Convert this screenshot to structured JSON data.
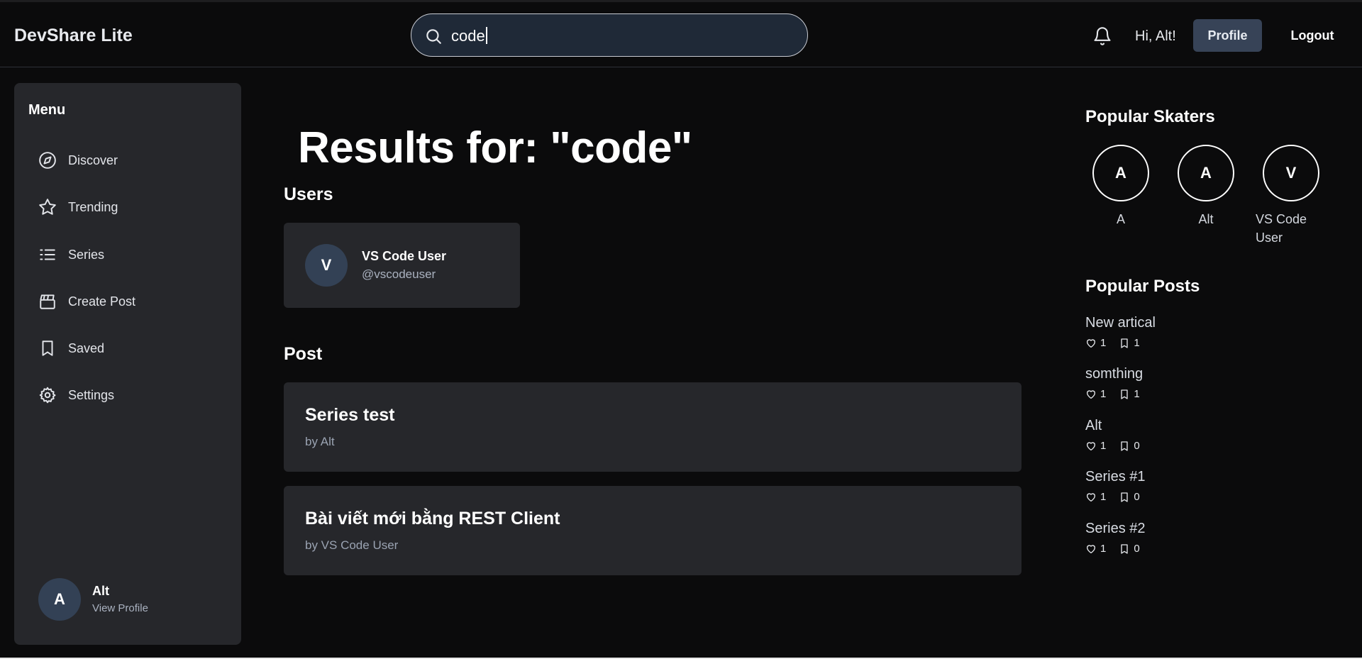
{
  "header": {
    "brand": "DevShare Lite",
    "search_value": "code",
    "greeting": "Hi, Alt!",
    "profile_label": "Profile",
    "logout_label": "Logout"
  },
  "sidebar": {
    "title": "Menu",
    "items": [
      {
        "label": "Discover",
        "icon": "compass-icon"
      },
      {
        "label": "Trending",
        "icon": "star-icon"
      },
      {
        "label": "Series",
        "icon": "list-icon"
      },
      {
        "label": "Create Post",
        "icon": "clapperboard-icon"
      },
      {
        "label": "Saved",
        "icon": "bookmark-icon"
      },
      {
        "label": "Settings",
        "icon": "gear-icon"
      }
    ],
    "user": {
      "initial": "A",
      "name": "Alt",
      "link": "View Profile"
    }
  },
  "main": {
    "title": "Results for: \"code\"",
    "users_heading": "Users",
    "users": [
      {
        "initial": "V",
        "name": "VS Code User",
        "handle": "@vscodeuser"
      }
    ],
    "posts_heading": "Post",
    "posts": [
      {
        "title": "Series test",
        "author": "by Alt"
      },
      {
        "title": "Bài viết mới bằng REST Client",
        "author": "by VS Code User"
      }
    ]
  },
  "right": {
    "skaters_heading": "Popular Skaters",
    "skaters": [
      {
        "initial": "A",
        "name": "A"
      },
      {
        "initial": "A",
        "name": "Alt"
      },
      {
        "initial": "V",
        "name": "VS Code User"
      }
    ],
    "posts_heading": "Popular Posts",
    "popular_posts": [
      {
        "title": "New artical",
        "likes": "1",
        "saves": "1"
      },
      {
        "title": "somthing",
        "likes": "1",
        "saves": "1"
      },
      {
        "title": "Alt",
        "likes": "1",
        "saves": "0"
      },
      {
        "title": "Series #1",
        "likes": "1",
        "saves": "0"
      },
      {
        "title": "Series #2",
        "likes": "1",
        "saves": "0"
      }
    ]
  },
  "colors": {
    "background": "#0b0b0c",
    "card": "#26272b",
    "search_bg": "#1f2937",
    "avatar_bg": "#334155",
    "profile_button": "#374357"
  }
}
